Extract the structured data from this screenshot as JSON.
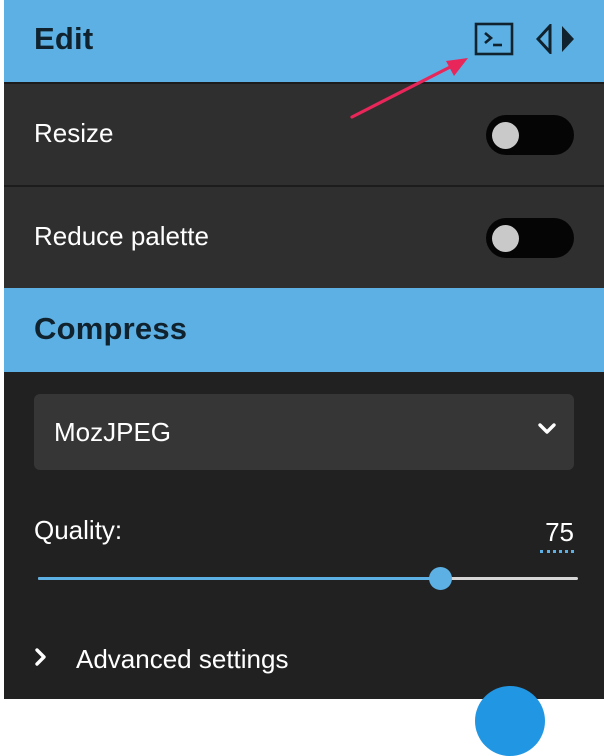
{
  "edit_section": {
    "title": "Edit",
    "options": [
      {
        "label": "Resize",
        "enabled": false
      },
      {
        "label": "Reduce palette",
        "enabled": false
      }
    ]
  },
  "compress_section": {
    "title": "Compress",
    "codec": {
      "selected": "MozJPEG"
    },
    "quality": {
      "label": "Quality:",
      "value": "75",
      "fraction": 0.75
    },
    "advanced": {
      "label": "Advanced settings"
    }
  },
  "icons": {
    "terminal": "terminal-icon",
    "compare_arrows": "split-arrows-icon",
    "chevron_down": "chevron-down-icon",
    "chevron_right": "chevron-right-icon"
  },
  "colors": {
    "header_bg": "#5db0e3",
    "header_text": "#10222e",
    "panel_bg": "#212121",
    "row_bg": "#2f2f2f",
    "accent": "#5db0e3",
    "annotation_arrow": "#e8265a"
  }
}
